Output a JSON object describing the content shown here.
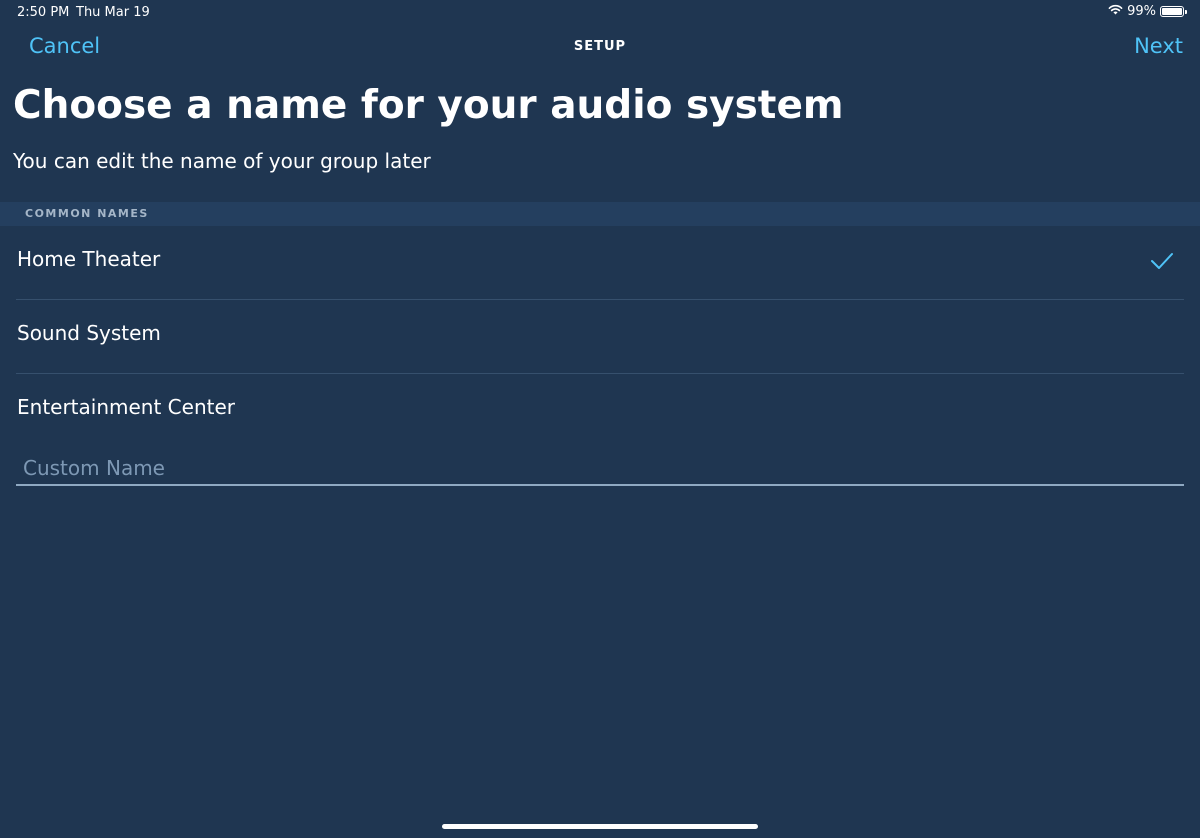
{
  "status_bar": {
    "time": "2:50 PM",
    "date": "Thu Mar 19",
    "battery_percent": "99%",
    "battery_level": 0.99,
    "wifi_icon": "wifi-icon",
    "battery_icon": "battery-icon"
  },
  "nav": {
    "cancel_label": "Cancel",
    "title": "SETUP",
    "next_label": "Next"
  },
  "page": {
    "title": "Choose a name for your audio system",
    "subtitle": "You can edit the name of your group later"
  },
  "common_names": {
    "header": "COMMON NAMES",
    "items": [
      {
        "label": "Home Theater",
        "selected": true
      },
      {
        "label": "Sound System",
        "selected": false
      },
      {
        "label": "Entertainment Center",
        "selected": false
      }
    ],
    "selected_icon": "checkmark-icon"
  },
  "custom_name": {
    "value": "",
    "placeholder": "Custom Name"
  },
  "colors": {
    "background": "#1f3651",
    "accent": "#4fc3f7",
    "section_header_bg": "#243f5f"
  }
}
